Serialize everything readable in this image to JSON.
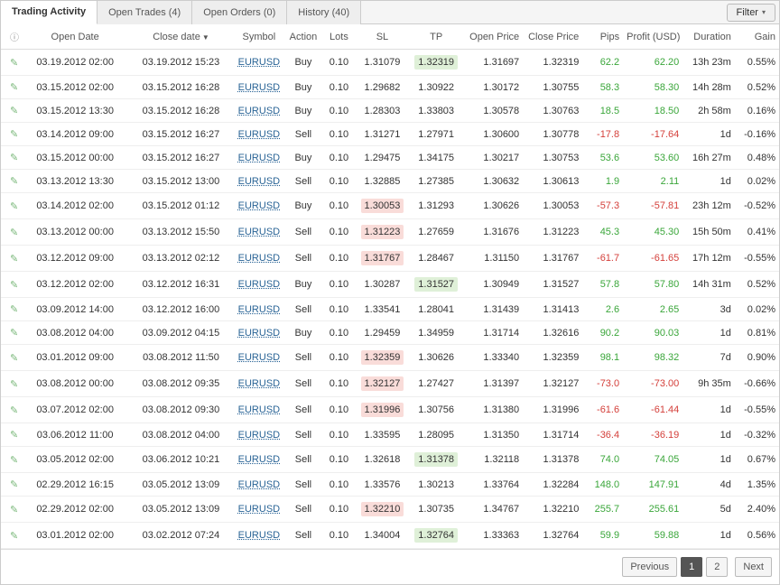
{
  "title": "Trading Activity",
  "tabs": [
    {
      "label": "Trading Activity",
      "active": true
    },
    {
      "label": "Open Trades (4)",
      "active": false
    },
    {
      "label": "Open Orders (0)",
      "active": false
    },
    {
      "label": "History (40)",
      "active": false
    }
  ],
  "filter_label": "Filter",
  "columns": {
    "open_date": "Open Date",
    "close_date": "Close date",
    "symbol": "Symbol",
    "action": "Action",
    "lots": "Lots",
    "sl": "SL",
    "tp": "TP",
    "open_price": "Open Price",
    "close_price": "Close Price",
    "pips": "Pips",
    "profit": "Profit (USD)",
    "duration": "Duration",
    "gain": "Gain"
  },
  "rows": [
    {
      "open_date": "03.19.2012 02:00",
      "close_date": "03.19.2012 15:23",
      "symbol": "EURUSD",
      "action": "Buy",
      "lots": "0.10",
      "sl": "1.31079",
      "tp": "1.32319",
      "tp_hl": "g",
      "open_price": "1.31697",
      "close_price": "1.32319",
      "pips": "62.2",
      "profit": "62.20",
      "duration": "13h 23m",
      "gain": "0.55%"
    },
    {
      "open_date": "03.15.2012 02:00",
      "close_date": "03.15.2012 16:28",
      "symbol": "EURUSD",
      "action": "Buy",
      "lots": "0.10",
      "sl": "1.29682",
      "tp": "1.30922",
      "open_price": "1.30172",
      "close_price": "1.30755",
      "pips": "58.3",
      "profit": "58.30",
      "duration": "14h 28m",
      "gain": "0.52%"
    },
    {
      "open_date": "03.15.2012 13:30",
      "close_date": "03.15.2012 16:28",
      "symbol": "EURUSD",
      "action": "Buy",
      "lots": "0.10",
      "sl": "1.28303",
      "tp": "1.33803",
      "open_price": "1.30578",
      "close_price": "1.30763",
      "pips": "18.5",
      "profit": "18.50",
      "duration": "2h 58m",
      "gain": "0.16%"
    },
    {
      "open_date": "03.14.2012 09:00",
      "close_date": "03.15.2012 16:27",
      "symbol": "EURUSD",
      "action": "Sell",
      "lots": "0.10",
      "sl": "1.31271",
      "tp": "1.27971",
      "open_price": "1.30600",
      "close_price": "1.30778",
      "pips": "-17.8",
      "profit": "-17.64",
      "duration": "1d",
      "gain": "-0.16%"
    },
    {
      "open_date": "03.15.2012 00:00",
      "close_date": "03.15.2012 16:27",
      "symbol": "EURUSD",
      "action": "Buy",
      "lots": "0.10",
      "sl": "1.29475",
      "tp": "1.34175",
      "open_price": "1.30217",
      "close_price": "1.30753",
      "pips": "53.6",
      "profit": "53.60",
      "duration": "16h 27m",
      "gain": "0.48%"
    },
    {
      "open_date": "03.13.2012 13:30",
      "close_date": "03.15.2012 13:00",
      "symbol": "EURUSD",
      "action": "Sell",
      "lots": "0.10",
      "sl": "1.32885",
      "tp": "1.27385",
      "open_price": "1.30632",
      "close_price": "1.30613",
      "pips": "1.9",
      "profit": "2.11",
      "duration": "1d",
      "gain": "0.02%"
    },
    {
      "open_date": "03.14.2012 02:00",
      "close_date": "03.15.2012 01:12",
      "symbol": "EURUSD",
      "action": "Buy",
      "lots": "0.10",
      "sl": "1.30053",
      "sl_hl": "r",
      "tp": "1.31293",
      "open_price": "1.30626",
      "close_price": "1.30053",
      "pips": "-57.3",
      "profit": "-57.81",
      "duration": "23h 12m",
      "gain": "-0.52%"
    },
    {
      "open_date": "03.13.2012 00:00",
      "close_date": "03.13.2012 15:50",
      "symbol": "EURUSD",
      "action": "Sell",
      "lots": "0.10",
      "sl": "1.31223",
      "sl_hl": "r",
      "tp": "1.27659",
      "open_price": "1.31676",
      "close_price": "1.31223",
      "pips": "45.3",
      "profit": "45.30",
      "duration": "15h 50m",
      "gain": "0.41%"
    },
    {
      "open_date": "03.12.2012 09:00",
      "close_date": "03.13.2012 02:12",
      "symbol": "EURUSD",
      "action": "Sell",
      "lots": "0.10",
      "sl": "1.31767",
      "sl_hl": "r",
      "tp": "1.28467",
      "open_price": "1.31150",
      "close_price": "1.31767",
      "pips": "-61.7",
      "profit": "-61.65",
      "duration": "17h 12m",
      "gain": "-0.55%"
    },
    {
      "open_date": "03.12.2012 02:00",
      "close_date": "03.12.2012 16:31",
      "symbol": "EURUSD",
      "action": "Buy",
      "lots": "0.10",
      "sl": "1.30287",
      "tp": "1.31527",
      "tp_hl": "g",
      "open_price": "1.30949",
      "close_price": "1.31527",
      "pips": "57.8",
      "profit": "57.80",
      "duration": "14h 31m",
      "gain": "0.52%"
    },
    {
      "open_date": "03.09.2012 14:00",
      "close_date": "03.12.2012 16:00",
      "symbol": "EURUSD",
      "action": "Sell",
      "lots": "0.10",
      "sl": "1.33541",
      "tp": "1.28041",
      "open_price": "1.31439",
      "close_price": "1.31413",
      "pips": "2.6",
      "profit": "2.65",
      "duration": "3d",
      "gain": "0.02%"
    },
    {
      "open_date": "03.08.2012 04:00",
      "close_date": "03.09.2012 04:15",
      "symbol": "EURUSD",
      "action": "Buy",
      "lots": "0.10",
      "sl": "1.29459",
      "tp": "1.34959",
      "open_price": "1.31714",
      "close_price": "1.32616",
      "pips": "90.2",
      "profit": "90.03",
      "duration": "1d",
      "gain": "0.81%"
    },
    {
      "open_date": "03.01.2012 09:00",
      "close_date": "03.08.2012 11:50",
      "symbol": "EURUSD",
      "action": "Sell",
      "lots": "0.10",
      "sl": "1.32359",
      "sl_hl": "r",
      "tp": "1.30626",
      "open_price": "1.33340",
      "close_price": "1.32359",
      "pips": "98.1",
      "profit": "98.32",
      "duration": "7d",
      "gain": "0.90%"
    },
    {
      "open_date": "03.08.2012 00:00",
      "close_date": "03.08.2012 09:35",
      "symbol": "EURUSD",
      "action": "Sell",
      "lots": "0.10",
      "sl": "1.32127",
      "sl_hl": "r",
      "tp": "1.27427",
      "open_price": "1.31397",
      "close_price": "1.32127",
      "pips": "-73.0",
      "profit": "-73.00",
      "duration": "9h 35m",
      "gain": "-0.66%"
    },
    {
      "open_date": "03.07.2012 02:00",
      "close_date": "03.08.2012 09:30",
      "symbol": "EURUSD",
      "action": "Sell",
      "lots": "0.10",
      "sl": "1.31996",
      "sl_hl": "r",
      "tp": "1.30756",
      "open_price": "1.31380",
      "close_price": "1.31996",
      "pips": "-61.6",
      "profit": "-61.44",
      "duration": "1d",
      "gain": "-0.55%"
    },
    {
      "open_date": "03.06.2012 11:00",
      "close_date": "03.08.2012 04:00",
      "symbol": "EURUSD",
      "action": "Sell",
      "lots": "0.10",
      "sl": "1.33595",
      "tp": "1.28095",
      "open_price": "1.31350",
      "close_price": "1.31714",
      "pips": "-36.4",
      "profit": "-36.19",
      "duration": "1d",
      "gain": "-0.32%"
    },
    {
      "open_date": "03.05.2012 02:00",
      "close_date": "03.06.2012 10:21",
      "symbol": "EURUSD",
      "action": "Sell",
      "lots": "0.10",
      "sl": "1.32618",
      "tp": "1.31378",
      "tp_hl": "g",
      "open_price": "1.32118",
      "close_price": "1.31378",
      "pips": "74.0",
      "profit": "74.05",
      "duration": "1d",
      "gain": "0.67%"
    },
    {
      "open_date": "02.29.2012 16:15",
      "close_date": "03.05.2012 13:09",
      "symbol": "EURUSD",
      "action": "Sell",
      "lots": "0.10",
      "sl": "1.33576",
      "tp": "1.30213",
      "open_price": "1.33764",
      "close_price": "1.32284",
      "pips": "148.0",
      "profit": "147.91",
      "duration": "4d",
      "gain": "1.35%"
    },
    {
      "open_date": "02.29.2012 02:00",
      "close_date": "03.05.2012 13:09",
      "symbol": "EURUSD",
      "action": "Sell",
      "lots": "0.10",
      "sl": "1.32210",
      "sl_hl": "r",
      "tp": "1.30735",
      "open_price": "1.34767",
      "close_price": "1.32210",
      "pips": "255.7",
      "profit": "255.61",
      "duration": "5d",
      "gain": "2.40%"
    },
    {
      "open_date": "03.01.2012 02:00",
      "close_date": "03.02.2012 07:24",
      "symbol": "EURUSD",
      "action": "Sell",
      "lots": "0.10",
      "sl": "1.34004",
      "tp": "1.32764",
      "tp_hl": "g",
      "open_price": "1.33363",
      "close_price": "1.32764",
      "pips": "59.9",
      "profit": "59.88",
      "duration": "1d",
      "gain": "0.56%"
    }
  ],
  "pagination": {
    "previous": "Previous",
    "next": "Next",
    "pages": [
      "1",
      "2"
    ],
    "active": "1"
  }
}
